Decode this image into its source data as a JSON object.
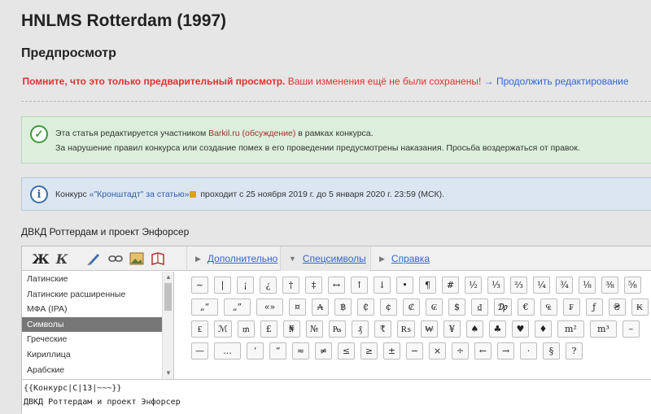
{
  "page": {
    "title": "HNLMS Rotterdam (1997)",
    "preview_heading": "Предпросмотр"
  },
  "notice": {
    "strong": "Помните, что это только предварительный просмотр.",
    "normal": " Ваши изменения ещё не были сохранены!",
    "link": " → Продолжить редактирование"
  },
  "contest_box": {
    "line1_pre": "Эта статья редактируется участником ",
    "user": "Barkil.ru",
    "talk": " (обсуждение)",
    "line1_post": " в рамках конкурса.",
    "line2": "За нарушение правил конкурса или создание помех в его проведении предусмотрены наказания. Просьба воздержаться от правок."
  },
  "info_box": {
    "pre": "Конкурс ",
    "contest_link": "«\"Кронштадт\" за статью»",
    "post": " проходит с 25 ноября 2019 г. до 5 января 2020 г. 23:59 (МСК)."
  },
  "summary_label": "ДВКД Роттердам и проект Энфорсер",
  "toolbar": {
    "bold": "Ж",
    "italic": "К",
    "tabs": [
      "Дополнительно",
      "Спецсимволы",
      "Справка"
    ]
  },
  "charlist": {
    "items": [
      "Латинские",
      "Латинские расширенные",
      "МФА (IPA)",
      "Символы",
      "Греческие",
      "Кириллица",
      "Арабские"
    ],
    "selected": "Символы"
  },
  "symbols": [
    "~",
    "|",
    "¡",
    "¿",
    "†",
    "‡",
    "↔",
    "↑",
    "↓",
    "•",
    "¶",
    "#",
    "½",
    "⅓",
    "⅔",
    "¼",
    "¾",
    "⅛",
    "⅜",
    "⅝",
    "„“",
    "„”",
    "«»",
    "¤",
    "₳",
    "฿",
    "₵",
    "¢",
    "₡",
    "₢",
    "$",
    "₫",
    "₯",
    "€",
    "₠",
    "₣",
    "ƒ",
    "₴",
    "₭",
    "₤",
    "ℳ",
    "₥",
    "£",
    "₦",
    "№",
    "₧",
    "₰",
    "₹",
    "₨",
    "₩",
    "¥",
    "♠",
    "♣",
    "♥",
    "♦",
    "m²",
    "m³",
    "–",
    "—",
    "...",
    "‘",
    "“",
    "≈",
    "≠",
    "≤",
    "≥",
    "±",
    "−",
    "×",
    "÷",
    "←",
    "→",
    "·",
    "§",
    "?"
  ],
  "textarea": {
    "line1": "{{Конкурс|С|13|~~~}}",
    "line2": "ДВКД Роттердам и проект Энфорсер"
  },
  "colors": {
    "warning_red": "#dd3333",
    "link_blue": "#3366cc",
    "success_green": "#3a9a3a",
    "info_blue": "#3a6fb0"
  }
}
